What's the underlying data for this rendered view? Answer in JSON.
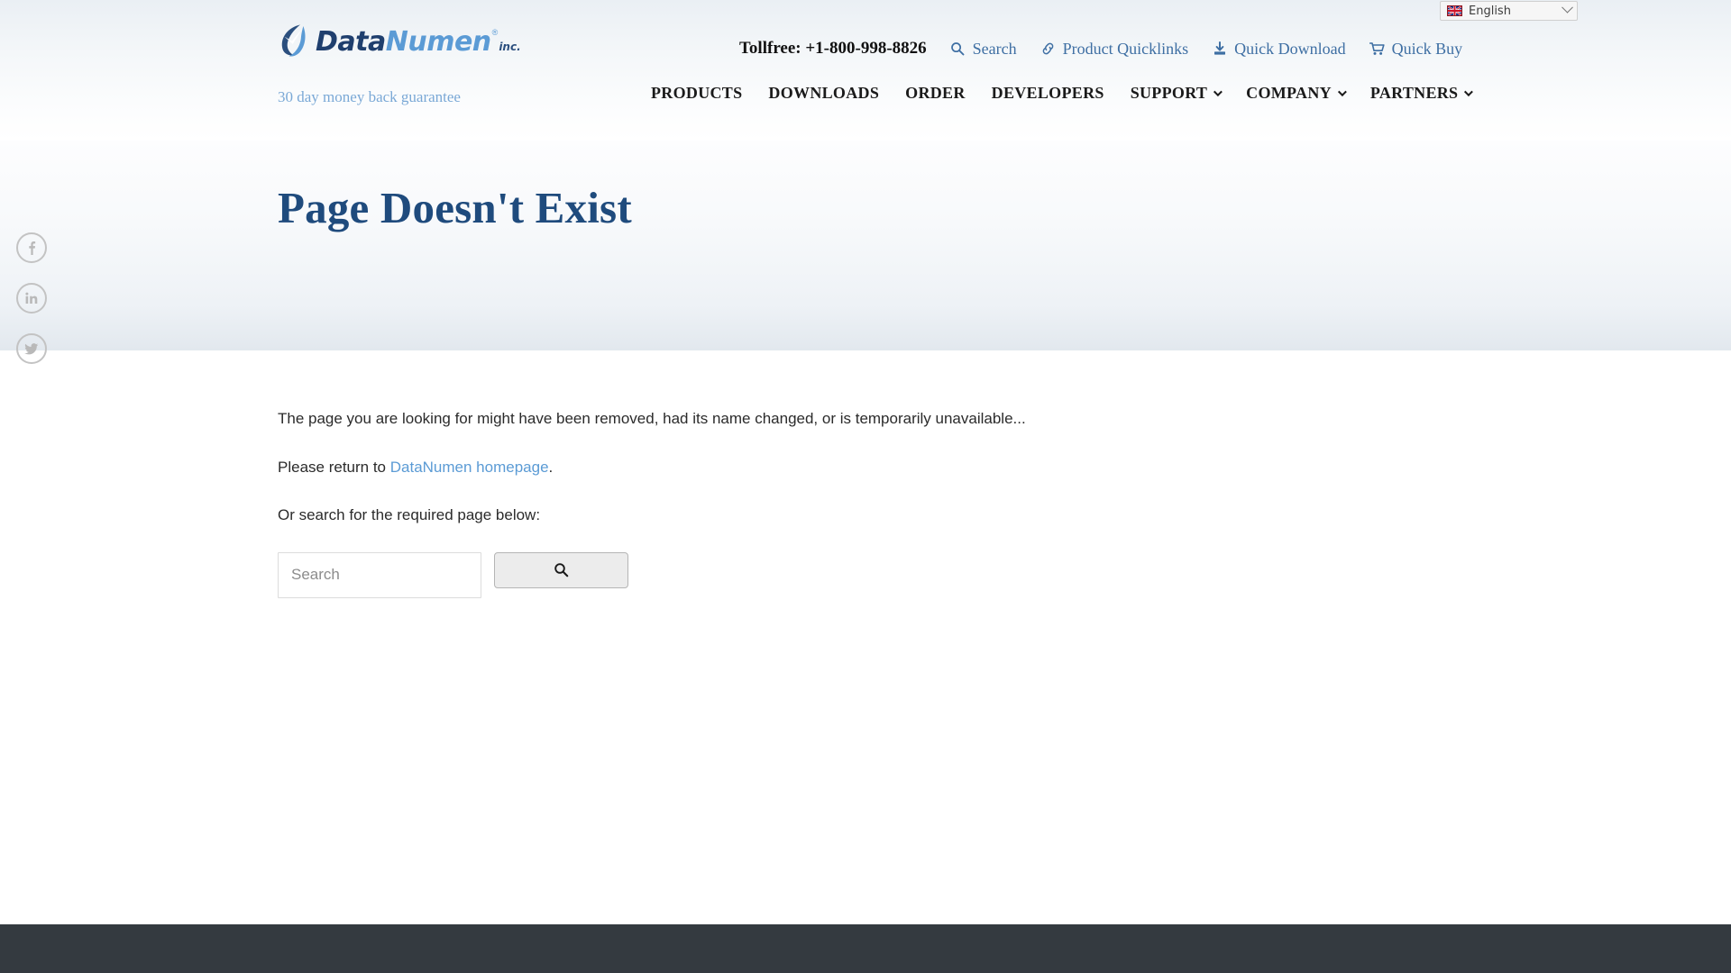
{
  "language_selector": {
    "selected": "English",
    "flag_icon": "uk-flag-icon",
    "chevron_icon": "chevron-down-icon"
  },
  "brand": {
    "name_part1": "Data",
    "name_part2": "Numen",
    "registered_mark": "®",
    "suffix": "inc.",
    "tagline": "30 day money back guarantee",
    "logo_primary_color": "#1f3f6e",
    "logo_accent_color": "#5b9bd5",
    "tagline_color": "#7aa8d6"
  },
  "utility_nav": {
    "phone_label": "Tollfree: +1-800-998-8826",
    "links": [
      {
        "label": "Search",
        "icon": "search-icon"
      },
      {
        "label": "Product Quicklinks",
        "icon": "link-chain-icon"
      },
      {
        "label": "Quick Download",
        "icon": "download-icon"
      },
      {
        "label": "Quick Buy",
        "icon": "shopping-cart-icon"
      }
    ],
    "link_color": "#3e6fa3"
  },
  "main_nav": {
    "items": [
      {
        "label": "PRODUCTS",
        "has_dropdown": false
      },
      {
        "label": "DOWNLOADS",
        "has_dropdown": false
      },
      {
        "label": "ORDER",
        "has_dropdown": false
      },
      {
        "label": "DEVELOPERS",
        "has_dropdown": false
      },
      {
        "label": "SUPPORT",
        "has_dropdown": true
      },
      {
        "label": "COMPANY",
        "has_dropdown": true
      },
      {
        "label": "PARTNERS",
        "has_dropdown": true
      }
    ]
  },
  "hero": {
    "title": "Page Doesn't Exist",
    "title_color": "#1f4b7d"
  },
  "social_rail": {
    "items": [
      {
        "label": "Facebook",
        "icon": "facebook-icon"
      },
      {
        "label": "LinkedIn",
        "icon": "linkedin-icon"
      },
      {
        "label": "Twitter",
        "icon": "twitter-icon"
      }
    ]
  },
  "main": {
    "paragraph_1": "The page you are looking for might have been removed, had its name changed, or is temporarily unavailable...",
    "paragraph_2_prefix": "Please return to ",
    "homepage_link_label": "DataNumen homepage",
    "paragraph_2_suffix": ".",
    "paragraph_3": "Or search for the required page below:",
    "search": {
      "placeholder": "Search",
      "value": "",
      "button_icon": "search-icon"
    },
    "link_color": "#5b9bd5"
  },
  "footer": {
    "background_color": "#343a40"
  }
}
